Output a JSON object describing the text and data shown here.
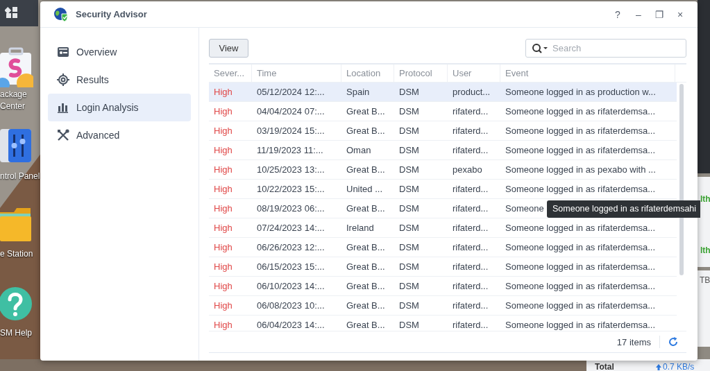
{
  "desktop": {
    "icons": [
      {
        "label": "ackage Center",
        "kind": "package"
      },
      {
        "label": "ntrol Panel",
        "kind": "panel"
      },
      {
        "label": "e Station",
        "kind": "folder"
      },
      {
        "label": "SM Help",
        "kind": "help"
      }
    ],
    "widgets": [
      {
        "text": "lth",
        "kind": "status"
      },
      {
        "text": "lth",
        "kind": "status"
      },
      {
        "text": "TB",
        "kind": "plain"
      },
      {
        "text": "Total",
        "kind": "menu"
      },
      {
        "text": "0.7 KB/s",
        "kind": "upload"
      }
    ]
  },
  "window": {
    "title": "Security Advisor",
    "controls": [
      "?",
      "–",
      "❐",
      "×"
    ]
  },
  "sidebar": {
    "items": [
      {
        "label": "Overview",
        "selected": false
      },
      {
        "label": "Results",
        "selected": false
      },
      {
        "label": "Login Analysis",
        "selected": true
      },
      {
        "label": "Advanced",
        "selected": false
      }
    ]
  },
  "toolbar": {
    "button": "View",
    "search": {
      "placeholder": "Search"
    }
  },
  "table": {
    "columns": [
      "Sever...",
      "Time",
      "Location",
      "Protocol",
      "User",
      "Event"
    ],
    "rows": [
      {
        "cells": [
          "High",
          "05/12/2024 12:...",
          "Spain",
          "DSM",
          "product...",
          "Someone logged in as production w..."
        ],
        "selected": true
      },
      {
        "cells": [
          "High",
          "04/04/2024 07:...",
          "Great B...",
          "DSM",
          "rifaterd...",
          "Someone logged in as rifaterdemsa..."
        ],
        "selected": false
      },
      {
        "cells": [
          "High",
          "03/19/2024 15:...",
          "Great B...",
          "DSM",
          "rifaterd...",
          "Someone logged in as rifaterdemsa..."
        ],
        "selected": false
      },
      {
        "cells": [
          "High",
          "11/19/2023 11:...",
          "Oman",
          "DSM",
          "rifaterd...",
          "Someone logged in as rifaterdemsa..."
        ],
        "selected": false
      },
      {
        "cells": [
          "High",
          "10/25/2023 13:...",
          "Great B...",
          "DSM",
          "pexabo",
          "Someone logged in as pexabo with ..."
        ],
        "selected": false
      },
      {
        "cells": [
          "High",
          "10/22/2023 15:...",
          "United ...",
          "DSM",
          "rifaterd...",
          "Someone logged in as rifaterdemsa..."
        ],
        "selected": false
      },
      {
        "cells": [
          "High",
          "08/19/2023 06:...",
          "Great B...",
          "DSM",
          "rifaterd...",
          "Someone"
        ],
        "selected": false
      },
      {
        "cells": [
          "High",
          "07/24/2023 14:...",
          "Ireland",
          "DSM",
          "rifaterd...",
          "Someone logged in as rifaterdemsa..."
        ],
        "selected": false
      },
      {
        "cells": [
          "High",
          "06/26/2023 12:...",
          "Great B...",
          "DSM",
          "rifaterd...",
          "Someone logged in as rifaterdemsa..."
        ],
        "selected": false
      },
      {
        "cells": [
          "High",
          "06/15/2023 15:...",
          "Great B...",
          "DSM",
          "rifaterd...",
          "Someone logged in as rifaterdemsa..."
        ],
        "selected": false
      },
      {
        "cells": [
          "High",
          "06/10/2023 14:...",
          "Great B...",
          "DSM",
          "rifaterd...",
          "Someone logged in as rifaterdemsa..."
        ],
        "selected": false
      },
      {
        "cells": [
          "High",
          "06/08/2023 10:...",
          "Great B...",
          "DSM",
          "rifaterd...",
          "Someone logged in as rifaterdemsa..."
        ],
        "selected": false
      },
      {
        "cells": [
          "High",
          "06/04/2023 14:...",
          "Great B...",
          "DSM",
          "rifaterd...",
          "Someone logged in as rifaterdemsa..."
        ],
        "selected": false
      }
    ],
    "footer": {
      "count": "17 items"
    }
  },
  "tooltip": {
    "text": "Someone logged in as rifaterdemsahi"
  }
}
